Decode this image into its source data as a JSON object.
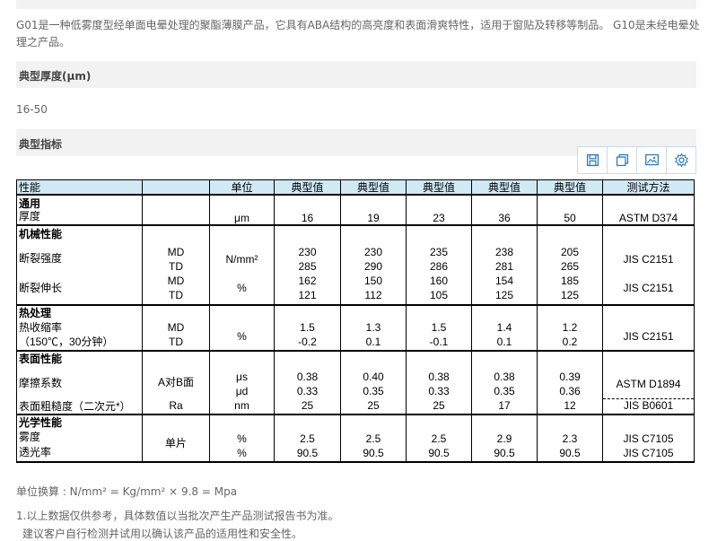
{
  "intro": "G01是一种低雾度型经单面电晕处理的聚酯薄膜产品，它具有ABA结构的高亮度和表面滑爽特性，适用于窗贴及转移等制品。 G10是未经电晕处理之产品。",
  "thickness_heading": "典型厚度(μm)",
  "thickness_value": "16-50",
  "spec_heading": "典型指标",
  "toolbar": [
    "save-icon",
    "copy-icon",
    "image-icon",
    "settings-icon"
  ],
  "table": {
    "headers": [
      "性能",
      "",
      "单位",
      "典型值",
      "典型值",
      "典型值",
      "典型值",
      "典型值",
      "测试方法"
    ],
    "general": {
      "group": "通用",
      "name": "厚度",
      "unit": "μm",
      "values": [
        "16",
        "19",
        "23",
        "36",
        "50"
      ],
      "method": "ASTM D374"
    },
    "mechanical": {
      "group": "机械性能",
      "tensile": {
        "name": "断裂强度",
        "dirs": [
          "MD",
          "TD"
        ],
        "unit": "N/mm²",
        "values": [
          [
            "230",
            "285"
          ],
          [
            "230",
            "290"
          ],
          [
            "235",
            "286"
          ],
          [
            "238",
            "281"
          ],
          [
            "205",
            "265"
          ]
        ],
        "method": "JIS C2151"
      },
      "elong": {
        "name": "断裂伸长",
        "dirs": [
          "MD",
          "TD"
        ],
        "unit": "%",
        "values": [
          [
            "162",
            "121"
          ],
          [
            "150",
            "112"
          ],
          [
            "160",
            "105"
          ],
          [
            "154",
            "125"
          ],
          [
            "185",
            "125"
          ]
        ],
        "method": "JIS C2151"
      }
    },
    "thermal": {
      "group": "热处理",
      "name": "热收缩率",
      "cond": "（150℃，30分钟）",
      "dirs": [
        "MD",
        "TD"
      ],
      "unit": "%",
      "values": [
        [
          "1.5",
          "-0.2"
        ],
        [
          "1.3",
          "0.1"
        ],
        [
          "1.5",
          "-0.1"
        ],
        [
          "1.4",
          "0.1"
        ],
        [
          "1.2",
          "0.2"
        ]
      ],
      "method": "JIS C2151"
    },
    "surface": {
      "group": "表面性能",
      "friction": {
        "name": "摩擦系数",
        "cond": "A对B面",
        "units": [
          "μs",
          "μd"
        ],
        "values": [
          [
            "0.38",
            "0.33"
          ],
          [
            "0.40",
            "0.35"
          ],
          [
            "0.38",
            "0.33"
          ],
          [
            "0.38",
            "0.35"
          ],
          [
            "0.39",
            "0.36"
          ]
        ],
        "method": "ASTM D1894"
      },
      "rough": {
        "name": "表面粗糙度（二次元*）",
        "cond": "Ra",
        "unit": "nm",
        "values": [
          "25",
          "25",
          "25",
          "17",
          "12"
        ],
        "method": "JIS B0601"
      }
    },
    "optical": {
      "group": "光学性能",
      "cond": "单片",
      "haze": {
        "name": "雾度",
        "unit": "%",
        "values": [
          "2.5",
          "2.5",
          "2.5",
          "2.9",
          "2.3"
        ],
        "method": "JIS C7105"
      },
      "trans": {
        "name": "透光率",
        "unit": "%",
        "values": [
          "90.5",
          "90.5",
          "90.5",
          "90.5",
          "90.5"
        ],
        "method": "JIS C7105"
      }
    }
  },
  "conversion": "单位换算 : N/mm² = Kg/mm² × 9.8 = Mpa",
  "note1": "1.以上数据仅供参考，具体数值以当批次产生产品测试报告书为准。",
  "note2": "建议客户自行检测并试用以确认该产品的适用性和安全性。"
}
